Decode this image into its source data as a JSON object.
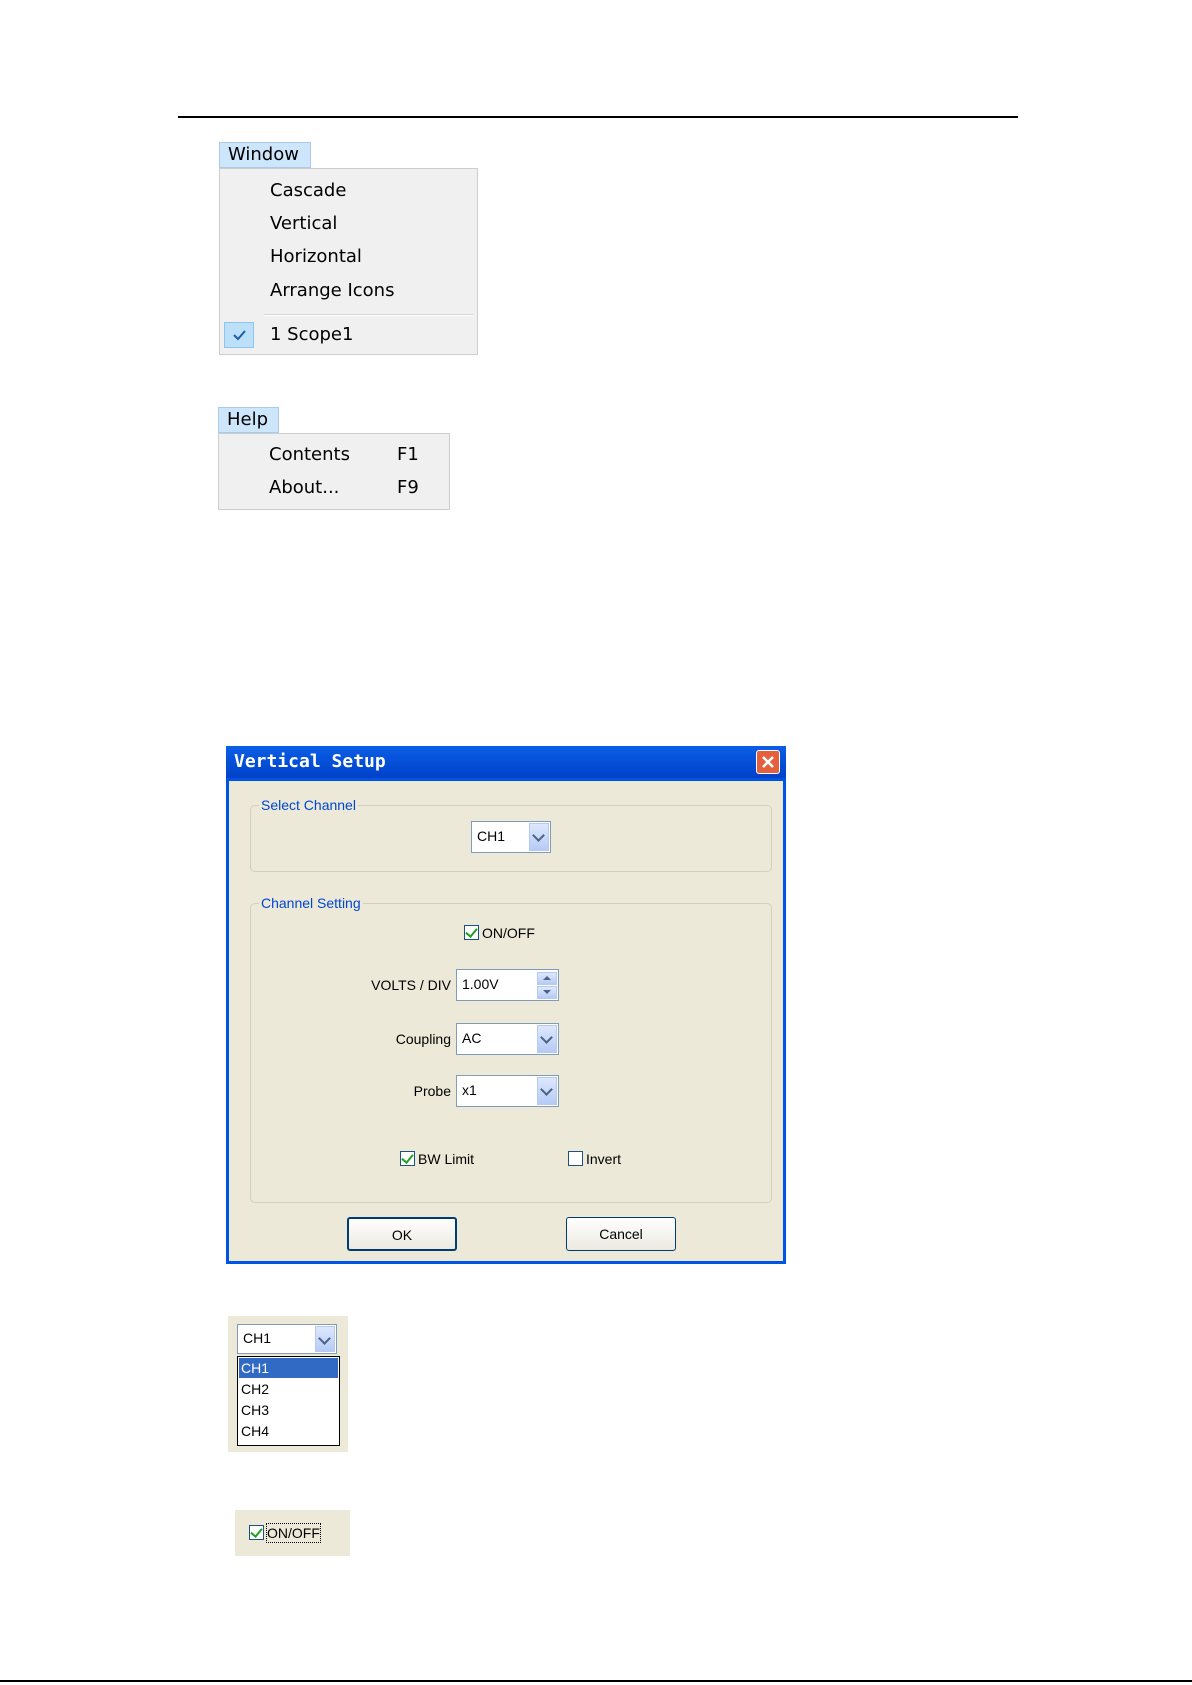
{
  "window_menu": {
    "title": "Window",
    "items": [
      "Cascade",
      "Vertical",
      "Horizontal",
      "Arrange Icons"
    ],
    "checked_item": "1 Scope1"
  },
  "help_menu": {
    "title": "Help",
    "items": [
      {
        "label": "Contents",
        "shortcut": "F1"
      },
      {
        "label": "About...",
        "shortcut": "F9"
      }
    ]
  },
  "dialog": {
    "title": "Vertical Setup",
    "select_channel": {
      "legend": "Select Channel",
      "value": "CH1"
    },
    "channel_setting": {
      "legend": "Channel Setting",
      "on_off_label": "ON/OFF",
      "on_off_checked": true,
      "volts_div_label": "VOLTS / DIV",
      "volts_div_value": "1.00V",
      "coupling_label": "Coupling",
      "coupling_value": "AC",
      "probe_label": "Probe",
      "probe_value": "x1",
      "bw_limit_label": "BW Limit",
      "bw_limit_checked": true,
      "invert_label": "Invert",
      "invert_checked": false
    },
    "ok_label": "OK",
    "cancel_label": "Cancel"
  },
  "channel_dropdown": {
    "value": "CH1",
    "options": [
      "CH1",
      "CH2",
      "CH3",
      "CH4"
    ],
    "selected": "CH1"
  },
  "onoff_snippet": {
    "label": "ON/OFF",
    "checked": true
  }
}
